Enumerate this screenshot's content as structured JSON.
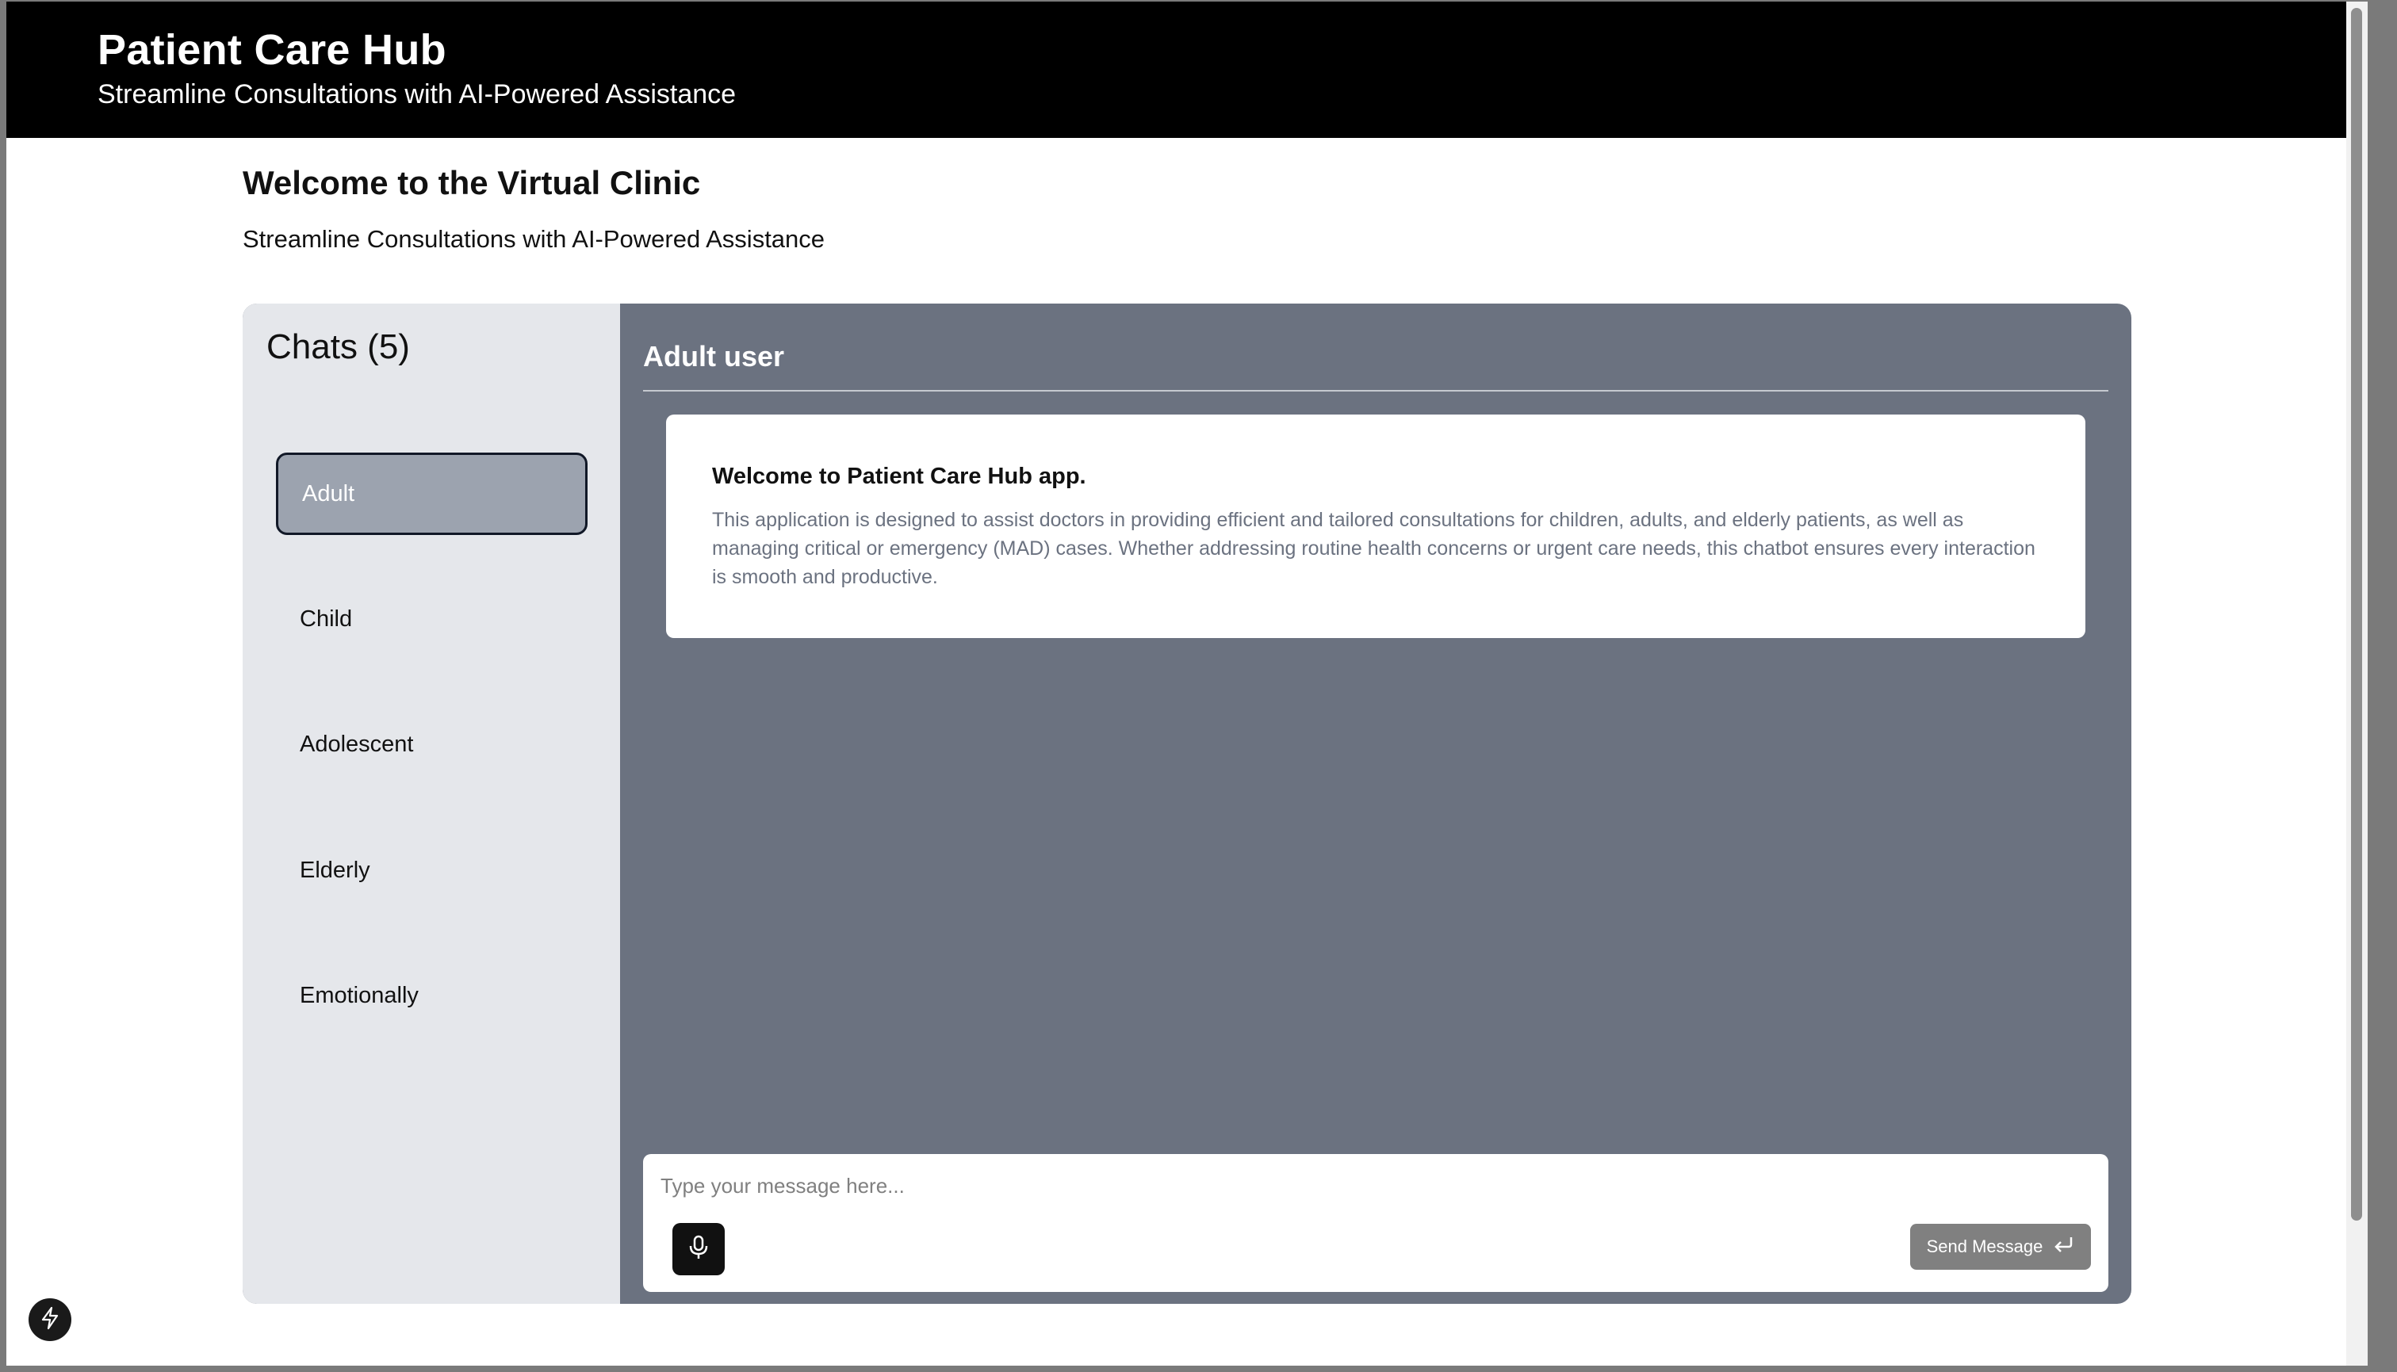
{
  "header": {
    "title": "Patient Care Hub",
    "subtitle": "Streamline Consultations with AI-Powered Assistance"
  },
  "page": {
    "title": "Welcome to the Virtual Clinic",
    "subtitle": "Streamline Consultations with AI-Powered Assistance"
  },
  "sidebar": {
    "title": "Chats (5)",
    "items": [
      {
        "label": "Adult",
        "active": true
      },
      {
        "label": "Child",
        "active": false
      },
      {
        "label": "Adolescent",
        "active": false
      },
      {
        "label": "Elderly",
        "active": false
      },
      {
        "label": "Emotionally",
        "active": false
      }
    ]
  },
  "chat": {
    "user_title": "Adult user",
    "welcome_title": "Welcome to Patient Care Hub app.",
    "welcome_body": "This application is designed to assist doctors in providing efficient and tailored consultations for children, adults, and elderly patients, as well as managing critical or emergency (MAD) cases. Whether addressing routine health concerns or urgent care needs, this chatbot ensures every interaction is smooth and productive.",
    "input_placeholder": "Type your message here...",
    "input_value": "",
    "send_label": "Send Message",
    "mic_icon": "microphone-icon",
    "send_icon": "enter-icon"
  },
  "colors": {
    "header_bg": "#000000",
    "sidebar_bg": "#e5e7eb",
    "chat_bg": "#6b7280",
    "active_item": "#9ca3af",
    "send_button": "#808080"
  }
}
